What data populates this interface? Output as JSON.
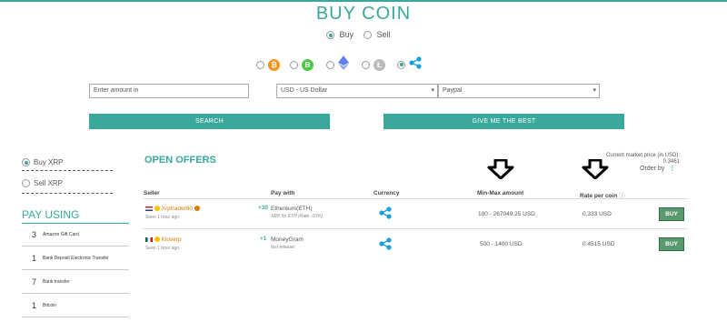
{
  "header": {
    "title": "BUY COIN"
  },
  "mode": {
    "buy_label": "Buy",
    "sell_label": "Sell",
    "selected": "Buy"
  },
  "coins": [
    {
      "name": "bitcoin",
      "icon": "bitcoin-icon",
      "color": "#f7931a",
      "glyph": "₿",
      "selected": false
    },
    {
      "name": "bitcoin-cash",
      "icon": "bitcoin-cash-icon",
      "color": "#4cc947",
      "glyph": "B",
      "selected": false
    },
    {
      "name": "ethereum",
      "icon": "ethereum-icon",
      "color": "#627eea",
      "glyph": "◆",
      "selected": false
    },
    {
      "name": "litecoin",
      "icon": "litecoin-icon",
      "color": "#bbbbbb",
      "glyph": "Ł",
      "selected": false
    },
    {
      "name": "ripple",
      "icon": "ripple-icon",
      "color": "#1ba1e2",
      "glyph": "",
      "selected": true
    }
  ],
  "search_form": {
    "amount_placeholder": "Enter amount in",
    "currency_value": "USD - US Dollar",
    "method_value": "Paypal",
    "search_label": "SEARCH",
    "best_label": "GIVE ME THE BEST"
  },
  "sidebar": {
    "buy_option": "Buy XRP",
    "sell_option": "Sell XRP",
    "pay_using_title": "PAY USING",
    "methods": [
      {
        "count": "3",
        "label": "Amazon Gift Card"
      },
      {
        "count": "1",
        "label": "Bank Deposit Electronic Transfer"
      },
      {
        "count": "7",
        "label": "Bank transfer"
      },
      {
        "count": "1",
        "label": "Bitcoin"
      }
    ]
  },
  "offers": {
    "title": "OPEN OFFERS",
    "market_price_label": "Current market price (in USD):",
    "market_price_value": "0.3461",
    "order_by_label": "Order by",
    "columns": {
      "seller": "Seller",
      "pay_with": "Pay with",
      "currency": "Currency",
      "min_max": "Min-Max amount",
      "rate": "Rate per coin"
    },
    "rows": [
      {
        "flag": "us-flag-icon",
        "seller": "Xrptrader90",
        "seen": "Seen 1 hour ago",
        "score": "+30",
        "pay_with": "Ethereum(ETH)",
        "pay_note": "XRP for ETH (Rate -10%)",
        "min_max": "100 - 267049.25 USD",
        "rate": "0.333 USD",
        "buy_label": "BUY"
      },
      {
        "flag": "mx-flag-icon",
        "seller": "Kloverp",
        "seen": "Seen 1 hour ago",
        "score": "+1",
        "pay_with": "MoneyGram",
        "pay_note": "fast release",
        "min_max": "500 - 1400 USD",
        "rate": "0.4515 USD",
        "buy_label": "BUY"
      }
    ]
  }
}
